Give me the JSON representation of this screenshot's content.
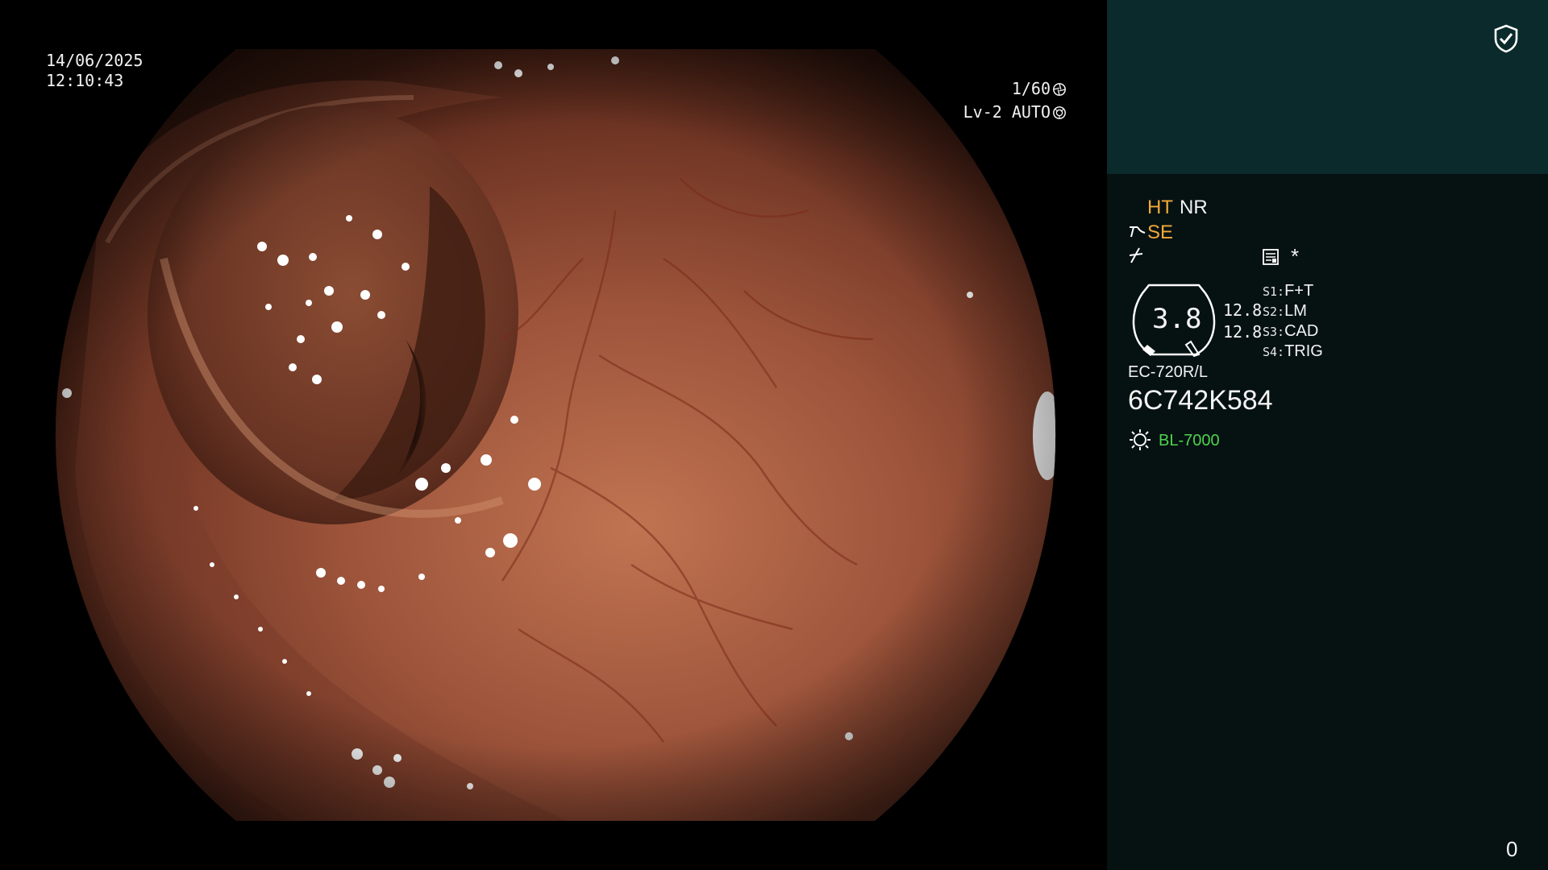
{
  "osd": {
    "date": "14/06/2025",
    "time": "12:10:43",
    "shutter": "1/60",
    "iris_level": "Lv-2 AUTO"
  },
  "panel": {
    "header_color": "#0b2a2b",
    "body_color": "#061111",
    "modes": {
      "ht": "HT",
      "nr": "NR",
      "se": "SE"
    },
    "asterisk": "*",
    "gauge": {
      "value": "3.8",
      "distance_1": "12.8",
      "distance_2": "12.8"
    },
    "switches": [
      {
        "key": "S1:",
        "value": "F+T"
      },
      {
        "key": "S2:",
        "value": "LM"
      },
      {
        "key": "S3:",
        "value": "CAD"
      },
      {
        "key": "S4:",
        "value": "TRIG"
      }
    ],
    "scope_model": "EC-720R/L",
    "scope_serial": "6C742K584",
    "light_source": "BL-7000",
    "page_counter": "0",
    "icons": [
      "shield-check-icon",
      "shutter-icon",
      "iris-icon",
      "se-icon",
      "slash-icon",
      "memo-icon",
      "gauge-icon",
      "light-source-icon"
    ],
    "accent_colors": {
      "amber": "#f2a93b",
      "green": "#4ed34e"
    }
  }
}
